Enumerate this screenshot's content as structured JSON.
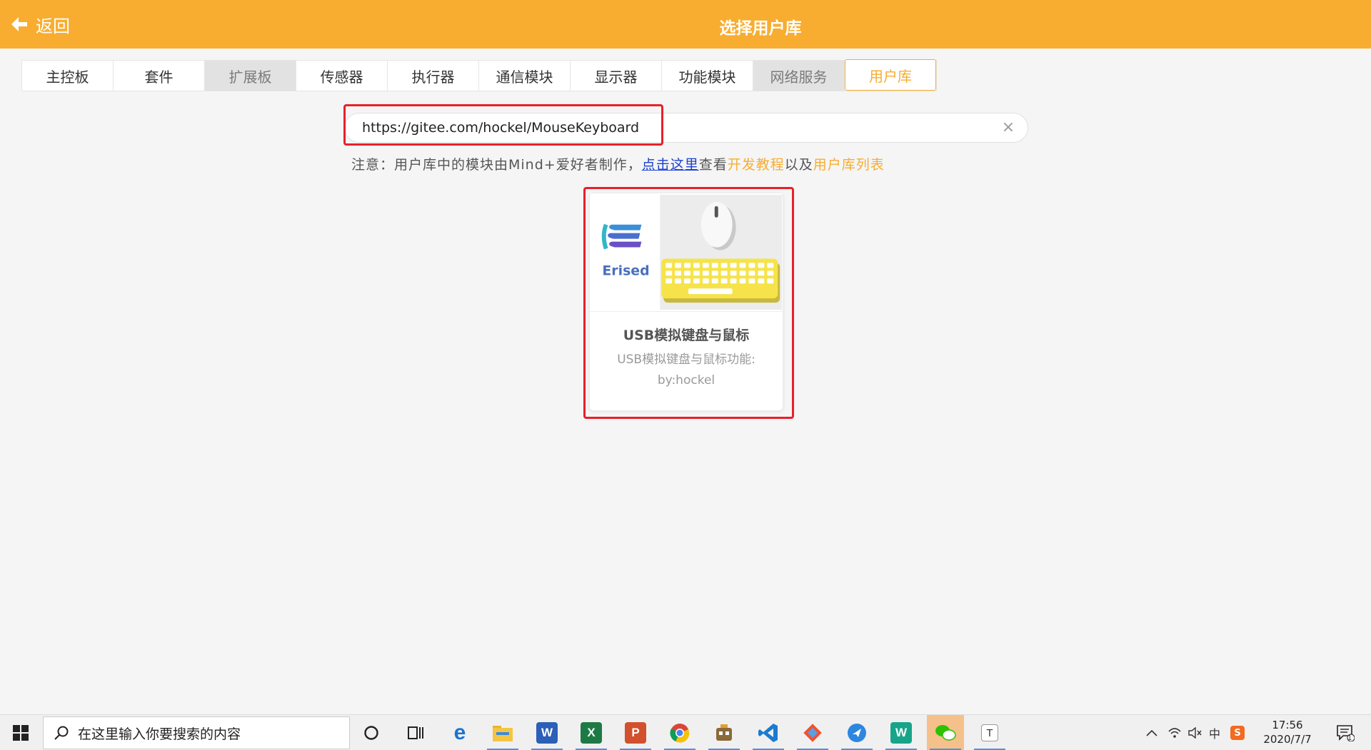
{
  "header": {
    "back_label": "返回",
    "title": "选择用户库",
    "bg_color": "#f8ad30"
  },
  "tabs": [
    {
      "label": "主控板",
      "state": "normal"
    },
    {
      "label": "套件",
      "state": "normal"
    },
    {
      "label": "扩展板",
      "state": "grey"
    },
    {
      "label": "传感器",
      "state": "normal"
    },
    {
      "label": "执行器",
      "state": "normal"
    },
    {
      "label": "通信模块",
      "state": "normal"
    },
    {
      "label": "显示器",
      "state": "normal"
    },
    {
      "label": "功能模块",
      "state": "normal"
    },
    {
      "label": "网络服务",
      "state": "grey"
    },
    {
      "label": "用户库",
      "state": "active"
    }
  ],
  "search": {
    "value": "https://gitee.com/hockel/MouseKeyboard",
    "clear_icon": "close-icon"
  },
  "note": {
    "prefix": "注意：用户库中的模块由Mind+爱好者制作，",
    "link": "点击这里",
    "middle1": "查看",
    "dev_tutorial": "开发教程",
    "middle2": "以及",
    "lib_list": "用户库列表"
  },
  "card": {
    "logo_text": "Erised",
    "title": "USB模拟键盘与鼠标",
    "description": "USB模拟键盘与鼠标功能:",
    "author": "by:hockel"
  },
  "taskbar": {
    "search_placeholder": "在这里输入你要搜索的内容",
    "apps": [
      "cortana-icon",
      "task-view-icon",
      "edge-icon",
      "file-explorer-icon",
      "word-icon",
      "excel-icon",
      "powerpoint-icon",
      "chrome-icon",
      "mindplus-icon",
      "vscode-icon",
      "git-icon",
      "feishu-icon",
      "wps-icon",
      "wechat-icon",
      "typora-icon"
    ],
    "tray_ime": "中",
    "time": "17:56",
    "date": "2020/7/7",
    "notification_count": "1"
  },
  "colors": {
    "accent": "#f8ad30",
    "highlight": "#e8202a",
    "link": "#1a3fd3"
  }
}
